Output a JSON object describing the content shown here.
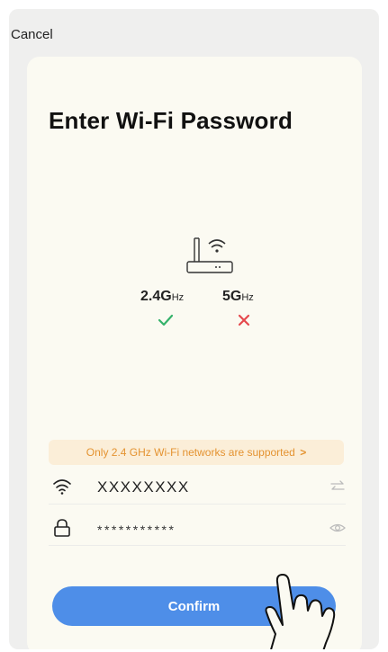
{
  "header": {
    "cancel_label": "Cancel"
  },
  "page": {
    "title": "Enter Wi-Fi Password"
  },
  "bands": {
    "b24": {
      "number": "2.4G",
      "unit": "Hz",
      "supported": true
    },
    "b5": {
      "number": "5G",
      "unit": "Hz",
      "supported": false
    }
  },
  "notice": {
    "text": "Only 2.4 GHz Wi-Fi networks are supported",
    "arrow": ">"
  },
  "form": {
    "ssid_value": "XXXXXXXX",
    "password_value": "***********"
  },
  "actions": {
    "confirm_label": "Confirm"
  },
  "colors": {
    "accent": "#4e8ee8",
    "notice_text": "#e49331",
    "notice_bg": "#fbeed8",
    "ok": "#35b26b",
    "error": "#e5484d"
  },
  "icons": {
    "router": "router-icon",
    "wifi": "wifi-icon",
    "lock": "lock-icon",
    "switch": "swap-arrows-icon",
    "eye": "eye-icon",
    "check": "check-icon",
    "cross": "cross-icon"
  }
}
